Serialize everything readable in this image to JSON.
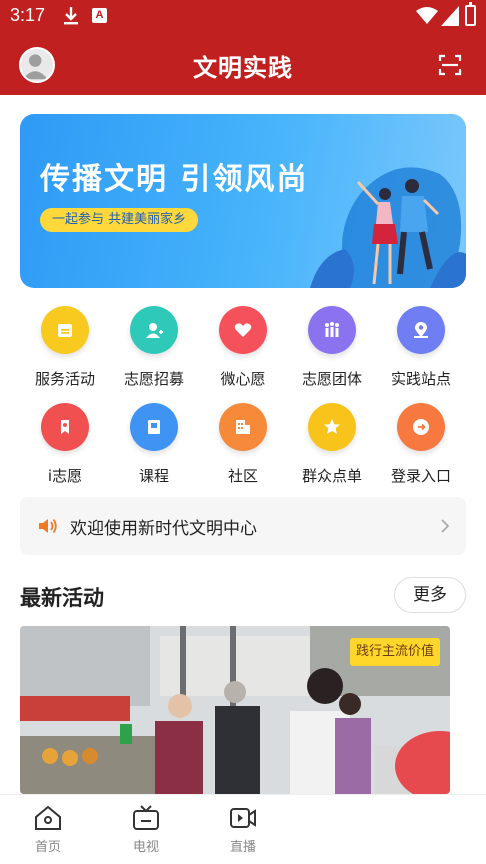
{
  "status_bar": {
    "time": "3:17",
    "badge": "A"
  },
  "header": {
    "title": "文明实践"
  },
  "banner": {
    "headline": "传播文明 引领风尚",
    "tagline": "一起参与 共建美丽家乡"
  },
  "grid": [
    {
      "label": "服务活动",
      "icon": "calendar-icon",
      "color": "#f8c91f"
    },
    {
      "label": "志愿招募",
      "icon": "user-add-icon",
      "color": "#2ec9b9"
    },
    {
      "label": "微心愿",
      "icon": "heart-icon",
      "color": "#f5515a"
    },
    {
      "label": "志愿团体",
      "icon": "group-icon",
      "color": "#8b73f0"
    },
    {
      "label": "实践站点",
      "icon": "location-icon",
      "color": "#6f7ef2"
    },
    {
      "label": "i志愿",
      "icon": "volunteer-icon",
      "color": "#f0504f"
    },
    {
      "label": "课程",
      "icon": "book-icon",
      "color": "#3f93f3"
    },
    {
      "label": "社区",
      "icon": "building-icon",
      "color": "#f7893a"
    },
    {
      "label": "群众点单",
      "icon": "star-icon",
      "color": "#f8c41b"
    },
    {
      "label": "登录入口",
      "icon": "login-icon",
      "color": "#f7793f"
    }
  ],
  "notice": {
    "text": "欢迎使用新时代文明中心"
  },
  "section": {
    "title": "最新活动",
    "more": "更多"
  },
  "activity": {
    "tag": "践行主流价值"
  },
  "bottom_nav": [
    {
      "label": "首页",
      "icon": "home-icon"
    },
    {
      "label": "电视",
      "icon": "tv-icon"
    },
    {
      "label": "直播",
      "icon": "live-icon"
    }
  ],
  "colors": {
    "brand_red": "#c0201f",
    "banner_blue": "#47b4fb",
    "tag_yellow": "#ffd72a"
  }
}
